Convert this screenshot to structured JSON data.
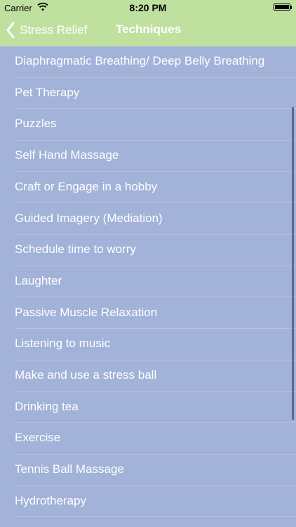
{
  "status_bar": {
    "carrier": "Carrier",
    "time": "8:20 PM"
  },
  "nav": {
    "back_label": "Stress Relief",
    "title": "Techniques"
  },
  "list": {
    "items": [
      "Diaphragmatic Breathing/ Deep Belly Breathing",
      "Pet Therapy",
      "Puzzles",
      "Self Hand Massage",
      "Craft or Engage in a hobby",
      "Guided Imagery (Mediation)",
      "Schedule time to worry",
      "Laughter",
      "Passive Muscle Relaxation",
      "Listening to music",
      "Make and use a stress ball",
      "Drinking tea",
      "Exercise",
      "Tennis Ball Massage",
      "Hydrotherapy"
    ]
  },
  "colors": {
    "nav_background": "#c0e0a0",
    "list_background": "#a2b2d8",
    "text": "#ffffff"
  },
  "icons": {
    "wifi": "wifi-icon",
    "battery": "battery-icon",
    "back": "chevron-left-icon"
  }
}
